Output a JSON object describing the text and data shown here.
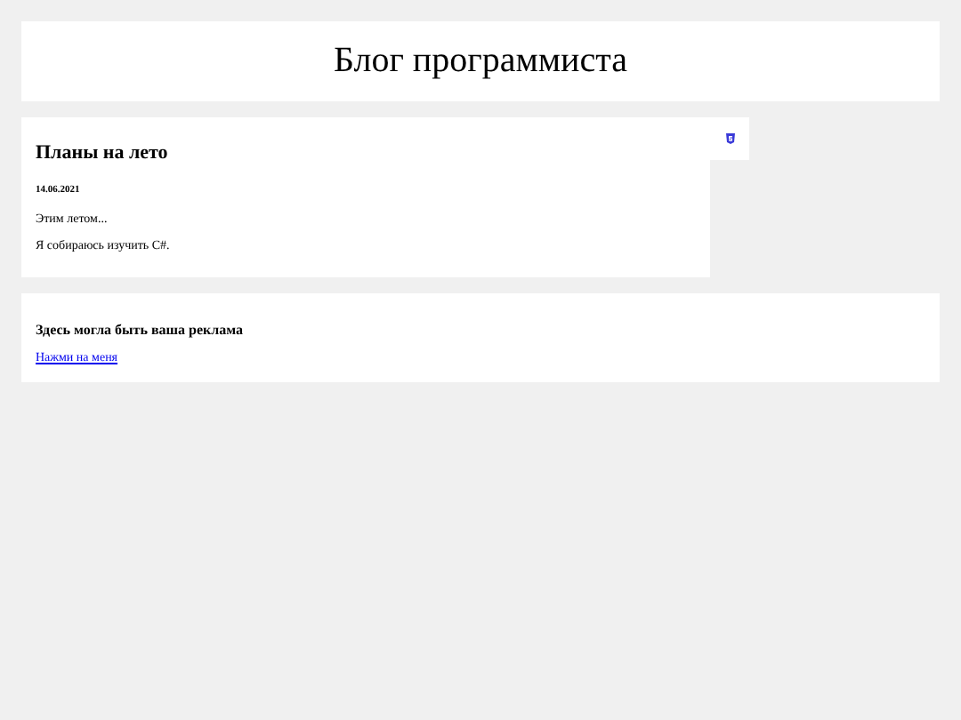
{
  "header": {
    "title": "Блог программиста"
  },
  "post": {
    "title": "Планы на лето",
    "date": "14.06.2021",
    "paragraphs": [
      "Этим летом...",
      "Я собираюсь изучить C#."
    ]
  },
  "ad": {
    "title": "Здесь могла быть ваша реклама",
    "link": "Нажми на меня"
  }
}
